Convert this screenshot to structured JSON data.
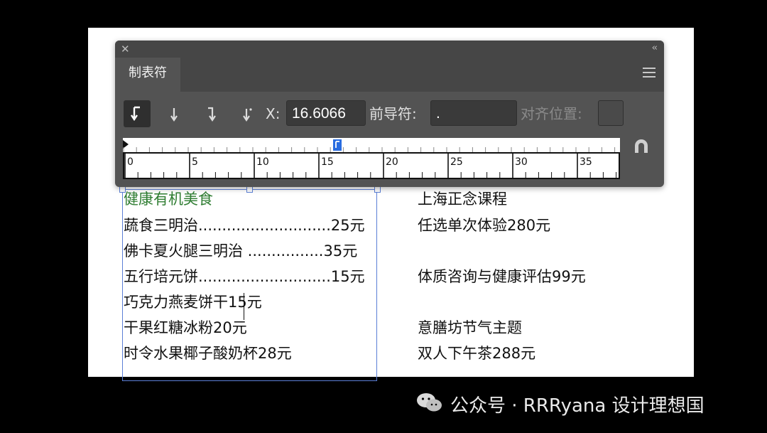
{
  "panel": {
    "title": "制表符",
    "tab_label": "制表符",
    "x_label": "X:",
    "x_value": "16.6066",
    "leader_label": "前导符:",
    "leader_value": ".",
    "align_label": "对齐位置:",
    "align_value": "",
    "ruler_ticks": [
      "0",
      "5",
      "10",
      "15",
      "20",
      "25",
      "30",
      "35"
    ]
  },
  "document": {
    "left_column": [
      {
        "text": "健康有机美食",
        "style": "heading"
      },
      {
        "text": "蔬食三明治............................25元"
      },
      {
        "text": "佛卡夏火腿三明治 ................35元"
      },
      {
        "text": "五行培元饼............................15元"
      },
      {
        "text": "巧克力燕麦饼干15元"
      },
      {
        "text": "干果红糖冰粉20元"
      },
      {
        "text": "时令水果椰子酸奶杯28元"
      }
    ],
    "right_column": [
      {
        "text": "上海正念课程"
      },
      {
        "text": "任选单次体验280元"
      },
      {
        "text": "体质咨询与健康评估99元"
      },
      {
        "text": "意膳坊节气主题"
      },
      {
        "text": "双人下午茶288元"
      }
    ]
  },
  "watermark": {
    "text": "公众号 · RRRyana 设计理想国"
  },
  "colors": {
    "panel_bg": "#535353",
    "accent_green": "#2f7d32",
    "frame_blue": "#5b7fd6"
  }
}
